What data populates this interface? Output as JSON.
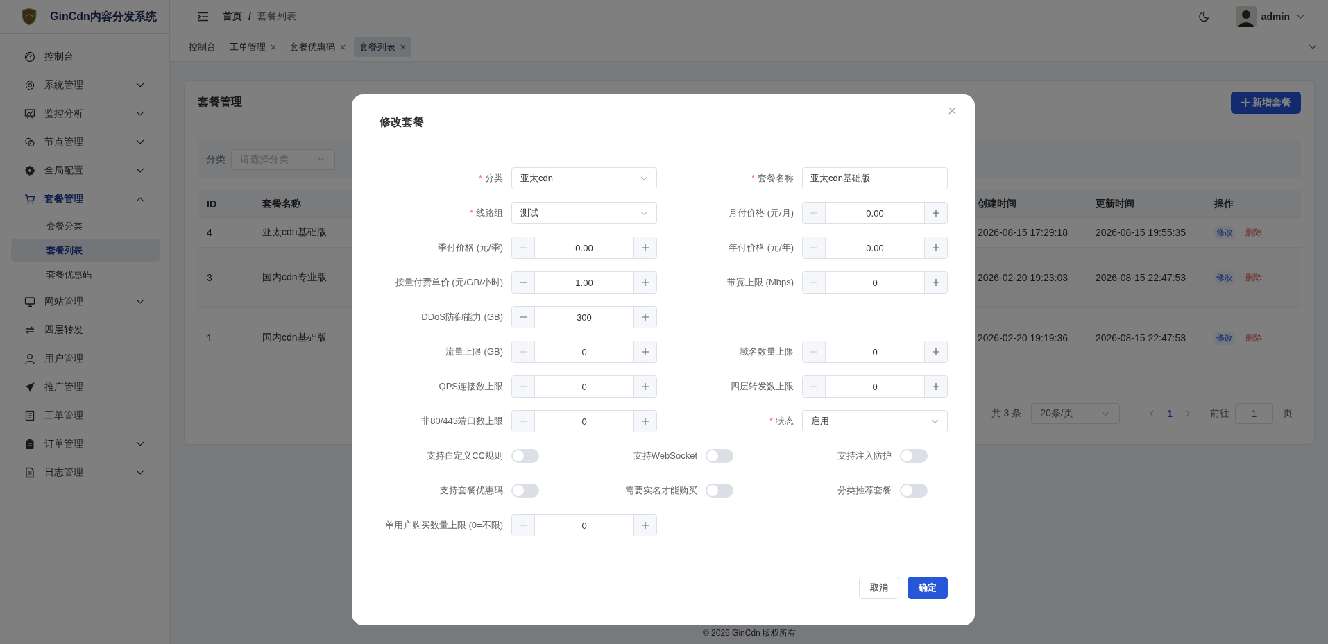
{
  "sidebar": {
    "logo_text": "GinCdn内容分发系统",
    "items": [
      {
        "label": "控制台",
        "kind": "item",
        "selected": false
      },
      {
        "label": "系统管理",
        "kind": "submenu",
        "selected": false,
        "expanded": false
      },
      {
        "label": "监控分析",
        "kind": "submenu",
        "selected": false,
        "expanded": false
      },
      {
        "label": "节点管理",
        "kind": "submenu",
        "selected": false,
        "expanded": false
      },
      {
        "label": "全局配置",
        "kind": "submenu",
        "selected": false,
        "expanded": false
      },
      {
        "label": "套餐管理",
        "kind": "submenu",
        "selected": true,
        "expanded": true,
        "children": [
          {
            "label": "套餐分类",
            "selected": false
          },
          {
            "label": "套餐列表",
            "selected": true
          },
          {
            "label": "套餐优惠码",
            "selected": false
          }
        ]
      },
      {
        "label": "网站管理",
        "kind": "submenu",
        "selected": false,
        "expanded": false
      },
      {
        "label": "四层转发",
        "kind": "item",
        "selected": false
      },
      {
        "label": "用户管理",
        "kind": "item",
        "selected": false
      },
      {
        "label": "推广管理",
        "kind": "item",
        "selected": false
      },
      {
        "label": "工单管理",
        "kind": "item",
        "selected": false
      },
      {
        "label": "订单管理",
        "kind": "submenu",
        "selected": false,
        "expanded": false
      },
      {
        "label": "日志管理",
        "kind": "submenu",
        "selected": false,
        "expanded": false
      }
    ]
  },
  "header": {
    "breadcrumb": [
      "首页",
      "套餐列表"
    ],
    "separator": "/",
    "user": "admin"
  },
  "tabs": [
    {
      "label": "控制台",
      "closable": false,
      "selected": false
    },
    {
      "label": "工单管理",
      "closable": true,
      "selected": false
    },
    {
      "label": "套餐优惠码",
      "closable": true,
      "selected": false
    },
    {
      "label": "套餐列表",
      "closable": true,
      "selected": true
    }
  ],
  "panel": {
    "title": "套餐管理",
    "add_button": "新增套餐",
    "filters": [
      {
        "label": "分类",
        "placeholder": "请选择分类"
      }
    ],
    "table": {
      "columns": [
        "ID",
        "套餐名称",
        "创建时间",
        "更新时间",
        "操作"
      ],
      "rows": [
        {
          "id": "4",
          "name": "亚太cdn基础版",
          "created": "2026-08-15 17:29:18",
          "updated": "2026-08-15 19:55:35",
          "actions": [
            {
              "label": "修改",
              "kind": "edit"
            },
            {
              "label": "删除",
              "kind": "delete"
            }
          ]
        },
        {
          "id": "3",
          "name": "国内cdn专业版",
          "created": "2026-02-20 19:23:03",
          "updated": "2026-08-15 22:47:53",
          "actions": [
            {
              "label": "修改",
              "kind": "edit"
            },
            {
              "label": "删除",
              "kind": "delete"
            }
          ]
        },
        {
          "id": "1",
          "name": "国内cdn基础版",
          "created": "2026-02-20 19:19:36",
          "updated": "2026-08-15 22:47:53",
          "actions": [
            {
              "label": "修改",
              "kind": "edit"
            },
            {
              "label": "删除",
              "kind": "delete"
            }
          ]
        }
      ]
    },
    "pagination": {
      "total": "共 3 条",
      "page_size": "20条/页",
      "pages": [
        {
          "label": "1",
          "selected": true
        }
      ],
      "goto_label": "前往",
      "goto_value": "1",
      "page_suffix": "页"
    }
  },
  "footer": "© 2026 GinCdn 版权所有",
  "dialog": {
    "title": "修改套餐",
    "required_mark": "*",
    "rows": [
      {
        "kind": "pair",
        "fields": [
          {
            "label": "分类",
            "required": true,
            "kind": "select",
            "value": "亚太cdn"
          },
          {
            "label": "套餐名称",
            "required": true,
            "kind": "text",
            "value": "亚太cdn基础版"
          }
        ]
      },
      {
        "kind": "pair",
        "fields": [
          {
            "label": "线路组",
            "required": true,
            "kind": "select",
            "value": "测试"
          },
          {
            "label": "月付价格 (元/月)",
            "required": false,
            "kind": "number",
            "value": "0.00",
            "decrease_disabled": true
          }
        ]
      },
      {
        "kind": "pair",
        "fields": [
          {
            "label": "季付价格 (元/季)",
            "required": false,
            "kind": "number",
            "value": "0.00",
            "decrease_disabled": true
          },
          {
            "label": "年付价格 (元/年)",
            "required": false,
            "kind": "number",
            "value": "0.00",
            "decrease_disabled": true
          }
        ]
      },
      {
        "kind": "pair",
        "fields": [
          {
            "label": "按量付费单价 (元/GB/小时)",
            "required": false,
            "kind": "number",
            "value": "1.00",
            "decrease_disabled": false
          },
          {
            "label": "带宽上限 (Mbps)",
            "required": false,
            "kind": "number",
            "value": "0",
            "decrease_disabled": true
          }
        ]
      },
      {
        "kind": "pair",
        "fields": [
          {
            "label": "DDoS防御能力 (GB)",
            "required": false,
            "kind": "number",
            "value": "300",
            "decrease_disabled": false
          }
        ]
      },
      {
        "kind": "pair",
        "fields": [
          {
            "label": "流量上限 (GB)",
            "required": false,
            "kind": "number",
            "value": "0",
            "decrease_disabled": true
          },
          {
            "label": "域名数量上限",
            "required": false,
            "kind": "number",
            "value": "0",
            "decrease_disabled": true
          }
        ]
      },
      {
        "kind": "pair",
        "fields": [
          {
            "label": "QPS连接数上限",
            "required": false,
            "kind": "number",
            "value": "0",
            "decrease_disabled": true
          },
          {
            "label": "四层转发数上限",
            "required": false,
            "kind": "number",
            "value": "0",
            "decrease_disabled": true
          }
        ]
      },
      {
        "kind": "pair",
        "fields": [
          {
            "label": "非80/443端口数上限",
            "required": false,
            "kind": "number",
            "value": "0",
            "decrease_disabled": true
          },
          {
            "label": "状态",
            "required": true,
            "kind": "select",
            "value": "启用"
          }
        ]
      },
      {
        "kind": "switches",
        "fields": [
          {
            "label": "支持自定义CC规则",
            "kind": "switch",
            "on": false
          },
          {
            "label": "支持WebSocket",
            "kind": "switch",
            "on": false
          },
          {
            "label": "支持注入防护",
            "kind": "switch",
            "on": false
          }
        ]
      },
      {
        "kind": "switches",
        "fields": [
          {
            "label": "支持套餐优惠码",
            "kind": "switch",
            "on": false
          },
          {
            "label": "需要实名才能购买",
            "kind": "switch",
            "on": false
          },
          {
            "label": "分类推荐套餐",
            "kind": "switch",
            "on": false
          }
        ]
      },
      {
        "kind": "pair",
        "fields": [
          {
            "label": "单用户购买数量上限 (0=不限)",
            "required": false,
            "kind": "number",
            "value": "0",
            "decrease_disabled": true
          }
        ]
      }
    ],
    "buttons": [
      {
        "label": "取消",
        "kind": "secondary"
      },
      {
        "label": "确定",
        "kind": "primary"
      }
    ]
  }
}
